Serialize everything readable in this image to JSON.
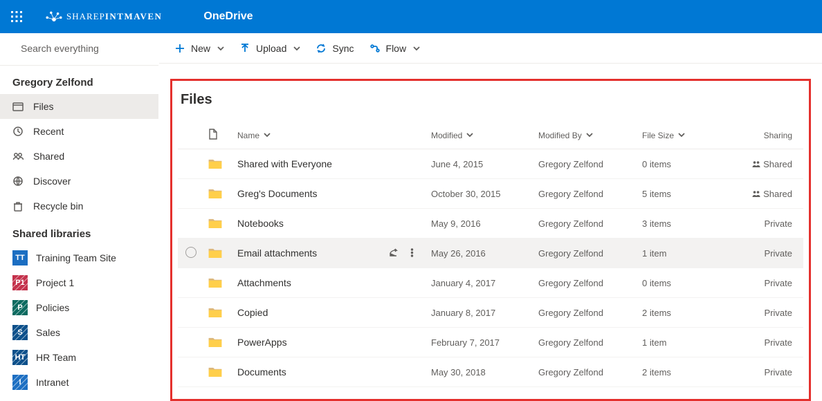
{
  "header": {
    "brand_thin": "SHAREP",
    "brand_bold": "INTMAVEN",
    "app_name": "OneDrive"
  },
  "search": {
    "placeholder": "Search everything"
  },
  "user": {
    "name": "Gregory Zelfond"
  },
  "nav": {
    "items": [
      {
        "label": "Files",
        "icon": "files-icon",
        "selected": true
      },
      {
        "label": "Recent",
        "icon": "recent-icon"
      },
      {
        "label": "Shared",
        "icon": "shared-icon"
      },
      {
        "label": "Discover",
        "icon": "discover-icon"
      },
      {
        "label": "Recycle bin",
        "icon": "recycle-icon"
      }
    ]
  },
  "shared_libraries": {
    "title": "Shared libraries",
    "items": [
      {
        "label": "Training Team Site",
        "abbrev": "TT",
        "color": "#1b6ec2"
      },
      {
        "label": "Project 1",
        "abbrev": "P1",
        "color": "#c4314b",
        "pattern": true
      },
      {
        "label": "Policies",
        "abbrev": "P",
        "color": "#0b6a5f",
        "pattern": true
      },
      {
        "label": "Sales",
        "abbrev": "S",
        "color": "#0b4f8a",
        "pattern": true
      },
      {
        "label": "HR Team",
        "abbrev": "HT",
        "color": "#0b4f8a",
        "pattern": true
      },
      {
        "label": "Intranet",
        "abbrev": "I",
        "color": "#1b6ec2",
        "pattern": true
      }
    ]
  },
  "commands": {
    "new": "New",
    "upload": "Upload",
    "sync": "Sync",
    "flow": "Flow"
  },
  "page": {
    "title": "Files"
  },
  "table": {
    "headers": {
      "name": "Name",
      "modified": "Modified",
      "modified_by": "Modified By",
      "file_size": "File Size",
      "sharing": "Sharing"
    },
    "rows": [
      {
        "name": "Shared with Everyone",
        "modified": "June 4, 2015",
        "by": "Gregory Zelfond",
        "size": "0 items",
        "sharing": "Shared",
        "shared": true
      },
      {
        "name": "Greg's Documents",
        "modified": "October 30, 2015",
        "by": "Gregory Zelfond",
        "size": "5 items",
        "sharing": "Shared",
        "shared": true
      },
      {
        "name": "Notebooks",
        "modified": "May 9, 2016",
        "by": "Gregory Zelfond",
        "size": "3 items",
        "sharing": "Private"
      },
      {
        "name": "Email attachments",
        "modified": "May 26, 2016",
        "by": "Gregory Zelfond",
        "size": "1 item",
        "sharing": "Private",
        "hovered": true
      },
      {
        "name": "Attachments",
        "modified": "January 4, 2017",
        "by": "Gregory Zelfond",
        "size": "0 items",
        "sharing": "Private"
      },
      {
        "name": "Copied",
        "modified": "January 8, 2017",
        "by": "Gregory Zelfond",
        "size": "2 items",
        "sharing": "Private"
      },
      {
        "name": "PowerApps",
        "modified": "February 7, 2017",
        "by": "Gregory Zelfond",
        "size": "1 item",
        "sharing": "Private"
      },
      {
        "name": "Documents",
        "modified": "May 30, 2018",
        "by": "Gregory Zelfond",
        "size": "2 items",
        "sharing": "Private"
      }
    ]
  },
  "colors": {
    "brand": "#0078d4",
    "highlight": "#e4302d",
    "folder_back": "#dcb67a",
    "folder_front": "#ffcf4b"
  }
}
